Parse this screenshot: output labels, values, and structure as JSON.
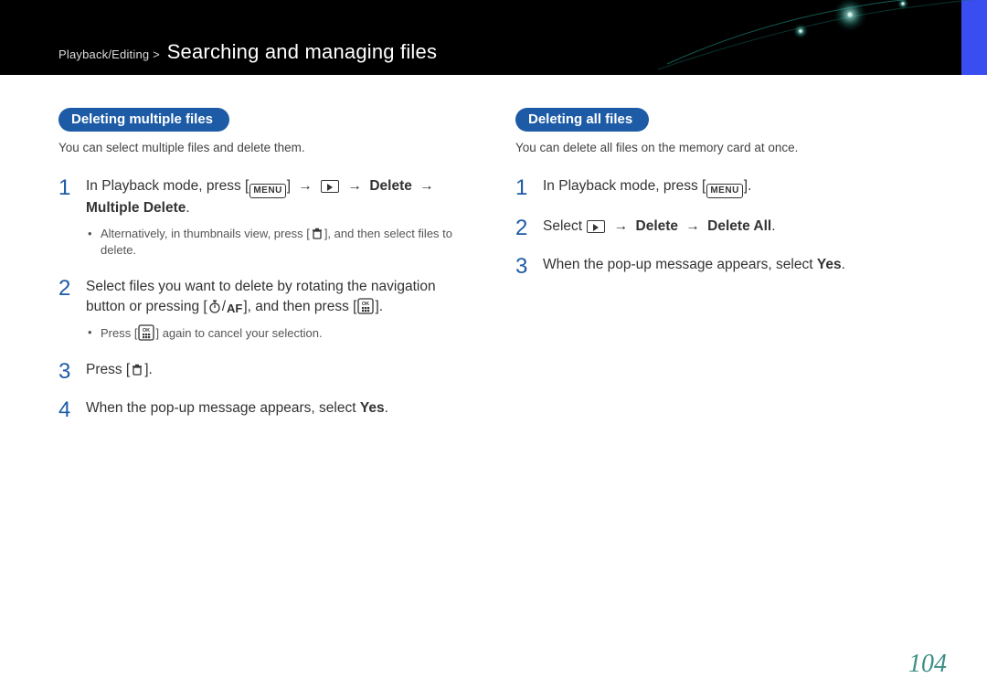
{
  "header": {
    "crumb": "Playback/Editing >",
    "title": "Searching and managing files"
  },
  "left": {
    "heading": "Deleting multiple files",
    "intro": "You can select multiple files and delete them.",
    "step1_a": "In Playback mode, press [",
    "step1_menu": "MENU",
    "step1_b": "] ",
    "arrow": "→",
    "step1_c": " ",
    "step1_delete": "Delete",
    "step1_multiple": "Multiple Delete",
    "step1_dot": ".",
    "step1_sub": "Alternatively, in thumbnails view, press [",
    "step1_sub2": "], and then select files to delete.",
    "step2_a": "Select files you want to delete by rotating the navigation button or pressing [",
    "step2_slash": "/",
    "step2_af": "AF",
    "step2_b": "], and then press [",
    "step2_c": "].",
    "step2_sub_a": "Press [",
    "step2_sub_b": "] again to cancel your selection.",
    "step3_a": "Press [",
    "step3_b": "].",
    "step4_a": "When the pop-up message appears, select ",
    "step4_yes": "Yes",
    "step4_b": "."
  },
  "right": {
    "heading": "Deleting all files",
    "intro": "You can delete all files on the memory card at once.",
    "step1_a": "In Playback mode, press [",
    "step1_menu": "MENU",
    "step1_b": "].",
    "step2_a": "Select ",
    "step2_delete": "Delete",
    "step2_all": "Delete All",
    "step2_b": ".",
    "step3_a": "When the pop-up message appears, select ",
    "step3_yes": "Yes",
    "step3_b": "."
  },
  "nums": {
    "n1": "1",
    "n2": "2",
    "n3": "3",
    "n4": "4"
  },
  "page_number": "104"
}
